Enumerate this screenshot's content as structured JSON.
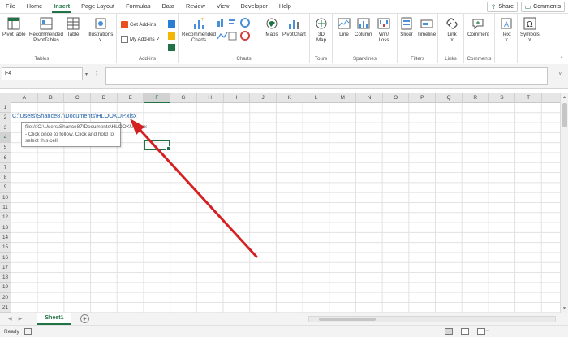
{
  "menu": {
    "items": [
      "File",
      "Home",
      "Insert",
      "Page Layout",
      "Formulas",
      "Data",
      "Review",
      "View",
      "Developer",
      "Help"
    ],
    "active": "Insert",
    "share_label": "Share",
    "comments_label": "Comments"
  },
  "ribbon": {
    "tables": {
      "label": "Tables",
      "pivot_table": "PivotTable",
      "recommended_pivot_line1": "Recommended",
      "recommended_pivot_line2": "PivotTables",
      "table": "Table"
    },
    "illustrations": {
      "label": "Illustrations"
    },
    "addins": {
      "label": "Add-ins",
      "get_addins": "Get Add-ins",
      "my_addins": "My Add-ins"
    },
    "charts": {
      "label": "Charts",
      "recommended_line1": "Recommended",
      "recommended_line2": "Charts",
      "maps": "Maps",
      "pivot_chart": "PivotChart"
    },
    "tours": {
      "label": "Tours",
      "map3d_line1": "3D",
      "map3d_line2": "Map"
    },
    "sparklines": {
      "label": "Sparklines",
      "line": "Line",
      "column": "Column",
      "winloss_line1": "Win/",
      "winloss_line2": "Loss"
    },
    "filters": {
      "label": "Filters",
      "slicer": "Slicer",
      "timeline": "Timeline"
    },
    "links": {
      "label": "Links",
      "link": "Link"
    },
    "comments": {
      "label": "Comments",
      "comment": "Comment"
    },
    "text": {
      "text": "Text"
    },
    "symbols": {
      "symbols": "Symbols"
    }
  },
  "formula_bar": {
    "name_box": "F4",
    "formula": ""
  },
  "grid": {
    "columns": [
      "A",
      "B",
      "C",
      "D",
      "E",
      "F",
      "G",
      "H",
      "I",
      "J",
      "K",
      "L",
      "M",
      "N",
      "O",
      "P",
      "Q",
      "R",
      "S",
      "T"
    ],
    "rows": [
      "1",
      "2",
      "3",
      "4",
      "5",
      "6",
      "7",
      "8",
      "9",
      "10",
      "11",
      "12",
      "13",
      "14",
      "15",
      "16",
      "17",
      "18",
      "19",
      "20",
      "21"
    ],
    "selected_column": "F",
    "selected_row": "4",
    "hyperlink_text": "C:\\Users\\Shance87\\Documents\\HLOOKUP.xlsx",
    "tooltip_text": "file:///C:\\Users\\Shance87\\Documents\\HLOOKUP.xlsx - Click once to follow. Click and hold to select this cell.",
    "annotation_arrow_color": "#d42020"
  },
  "sheets": {
    "tabs": [
      "Sheet1"
    ],
    "active": "Sheet1"
  },
  "status": {
    "text": "Ready"
  },
  "colors": {
    "accent": "#217346",
    "link": "#1f5fa8"
  }
}
